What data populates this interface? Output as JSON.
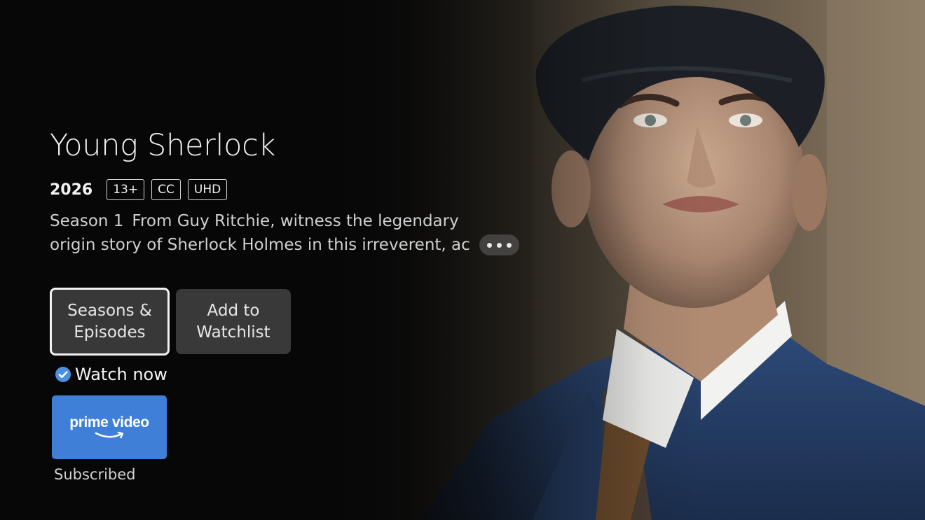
{
  "show": {
    "title": "Young Sherlock",
    "year": "2026",
    "badges": [
      "13+",
      "CC",
      "UHD"
    ],
    "season_label": "Season 1",
    "synopsis_line1": "From Guy Ritchie, witness the legendary",
    "synopsis_line2": "origin story of Sherlock Holmes in this irreverent, ac"
  },
  "actions": {
    "seasons_line1": "Seasons &",
    "seasons_line2": "Episodes",
    "watchlist_line1": "Add to",
    "watchlist_line2": "Watchlist"
  },
  "watch": {
    "label": "Watch now",
    "provider_logo_text": "prime video",
    "provider_status": "Subscribed"
  },
  "icons": {
    "more": "ellipsis-icon",
    "check": "check-circle-icon",
    "provider": "prime-video-logo"
  },
  "colors": {
    "background": "#070707",
    "provider_tile": "#3f7fd7",
    "check": "#4a90e2",
    "button": "#3f3f3f",
    "focus_border": "#f2f2f2"
  }
}
